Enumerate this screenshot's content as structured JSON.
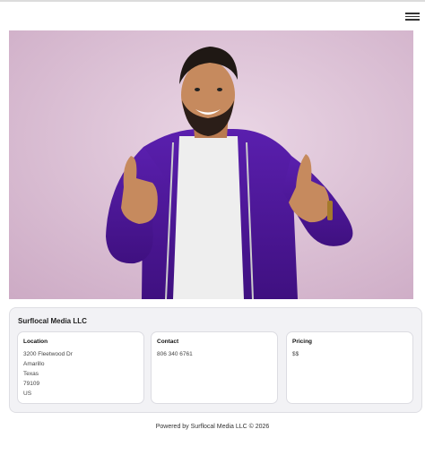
{
  "header": {
    "menu_icon": "hamburger-menu-icon"
  },
  "hero": {
    "image_alt": "Smiling man in purple hoodie giving two thumbs up"
  },
  "business": {
    "name": "Surflocal Media LLC",
    "location": {
      "title": "Location",
      "street": "3200 Fleetwood Dr",
      "city": "Amarillo",
      "state": "Texas",
      "zip": "79109",
      "country": "US"
    },
    "contact": {
      "title": "Contact",
      "phone": "806 340 6761"
    },
    "pricing": {
      "title": "Pricing",
      "value": "$$"
    }
  },
  "footer": {
    "text": "Powered by Surflocal Media LLC © 2026"
  },
  "colors": {
    "hoodie": "#4a1596",
    "background": "#d9bdd2",
    "card_bg": "#f2f2f5"
  }
}
